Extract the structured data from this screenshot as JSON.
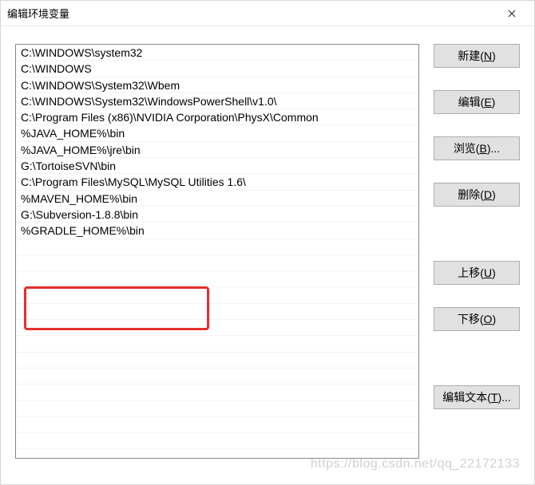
{
  "dialog": {
    "title": "编辑环境变量"
  },
  "list": {
    "items": [
      "C:\\WINDOWS\\system32",
      "C:\\WINDOWS",
      "C:\\WINDOWS\\System32\\Wbem",
      "C:\\WINDOWS\\System32\\WindowsPowerShell\\v1.0\\",
      "C:\\Program Files (x86)\\NVIDIA Corporation\\PhysX\\Common",
      "%JAVA_HOME%\\bin",
      "%JAVA_HOME%\\jre\\bin",
      "G:\\TortoiseSVN\\bin",
      "C:\\Program Files\\MySQL\\MySQL Utilities 1.6\\",
      "%MAVEN_HOME%\\bin",
      "G:\\Subversion-1.8.8\\bin",
      "%GRADLE_HOME%\\bin"
    ]
  },
  "buttons": {
    "new": {
      "label": "新建(",
      "accel": "N",
      "suffix": ")"
    },
    "edit": {
      "label": "编辑(",
      "accel": "E",
      "suffix": ")"
    },
    "browse": {
      "label": "浏览(",
      "accel": "B",
      "suffix": ")..."
    },
    "delete": {
      "label": "删除(",
      "accel": "D",
      "suffix": ")"
    },
    "moveup": {
      "label": "上移(",
      "accel": "U",
      "suffix": ")"
    },
    "movedown": {
      "label": "下移(",
      "accel": "O",
      "suffix": ")"
    },
    "edittext": {
      "label": "编辑文本(",
      "accel": "T",
      "suffix": ")..."
    }
  },
  "watermark": "https://blog.csdn.net/qq_22172133"
}
